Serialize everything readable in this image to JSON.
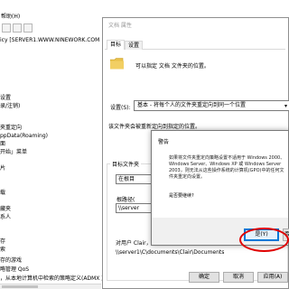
{
  "console": {
    "menu": [
      "帮助(H)"
    ],
    "menu_prefix": " ",
    "policy_line": "icy [SERVER1.WWW.NINEWORK.COM]",
    "tree": [
      "设置",
      "录/注销)",
      "",
      "",
      "夹重定向",
      "ppData(Roaming)",
      "面",
      "开始」菜单",
      "",
      "片",
      "",
      "",
      "载",
      "",
      "藏夹",
      "系人",
      "",
      "",
      "存",
      "索",
      "存的游戏",
      "略管理 QoS",
      "，从本地计算机中检索的策略定义(ADMX 文件"
    ]
  },
  "props": {
    "title": "文档 属性",
    "tabs": [
      "目标",
      "设置"
    ],
    "description": "可以指定 文档 文件夹的位置。",
    "setting_label": "设置(S):",
    "setting_value": "基本 - 将每个人的文件夹重定向到同一个位置",
    "hint": "该文件夹会被重新定向到指定的位置。",
    "group_title": "目标文件夹",
    "location_value": "在根目",
    "root_label": "根路径(",
    "root_value": "\\\\server",
    "example_label": "对用户 Clair，此文件夹将被重定向到:",
    "example_path": "\\\\server1\\C\\documents\\Clair\\Documents",
    "buttons": {
      "ok": "确定",
      "cancel": "取消",
      "apply": "应用(A)"
    }
  },
  "warning": {
    "title": "警告",
    "message": "如果将文件夹重定向策略设置不适用于 Windows 2000、Windows Server、Windows XP 或 Windows Server 2003，则无法从这些操作系统的计算机(GPO)中的任何文件夹重定向设置。",
    "question": "是否要继续?",
    "yes": "是(Y)",
    "no": "否"
  },
  "colors": {
    "accent": "#0078d7",
    "highlight_circle": "#e00000",
    "folder": "#e8c04a"
  }
}
